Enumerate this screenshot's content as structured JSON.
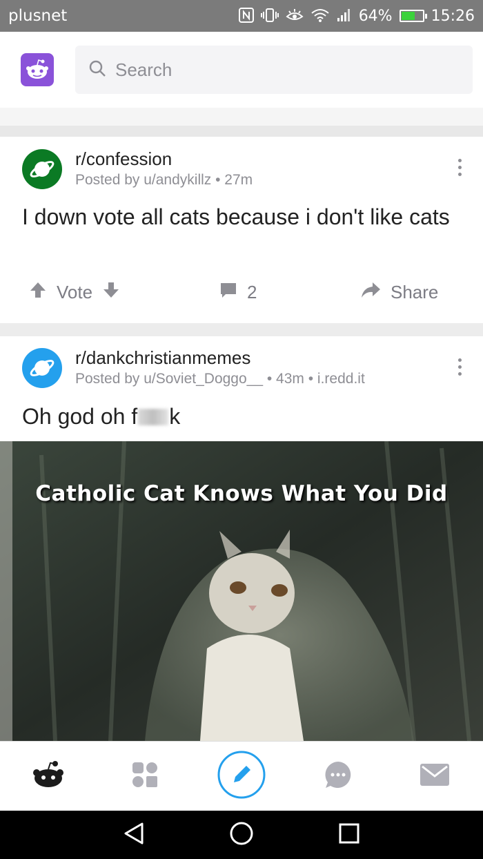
{
  "status_bar": {
    "carrier": "plusnet",
    "signal_percent": "64%",
    "battery_level": 0.64,
    "time": "15:26",
    "icons": [
      "nfc-icon",
      "vibrate-icon",
      "eye-comfort-icon",
      "wifi-icon",
      "signal-icon",
      "battery-icon"
    ]
  },
  "header": {
    "search_placeholder": "Search"
  },
  "posts": [
    {
      "subreddit": "r/confession",
      "byline": "Posted by u/andykillz • 27m",
      "title": "I down vote all cats because i don't like cats",
      "vote_label": "Vote",
      "comment_count": "2",
      "share_label": "Share",
      "icon_color": "#0b7a24"
    },
    {
      "subreddit": "r/dankchristianmemes",
      "byline": "Posted by u/Soviet_Doggo__ • 43m • i.redd.it",
      "title": "Oh god oh f",
      "title_end": "k",
      "meme_caption": "Catholic Cat Knows What You Did",
      "icon_color": "#24a0ed"
    }
  ],
  "colors": {
    "accent": "#24a0ed",
    "status_bar": "#7b7b7b",
    "muted": "#8e8e94"
  }
}
